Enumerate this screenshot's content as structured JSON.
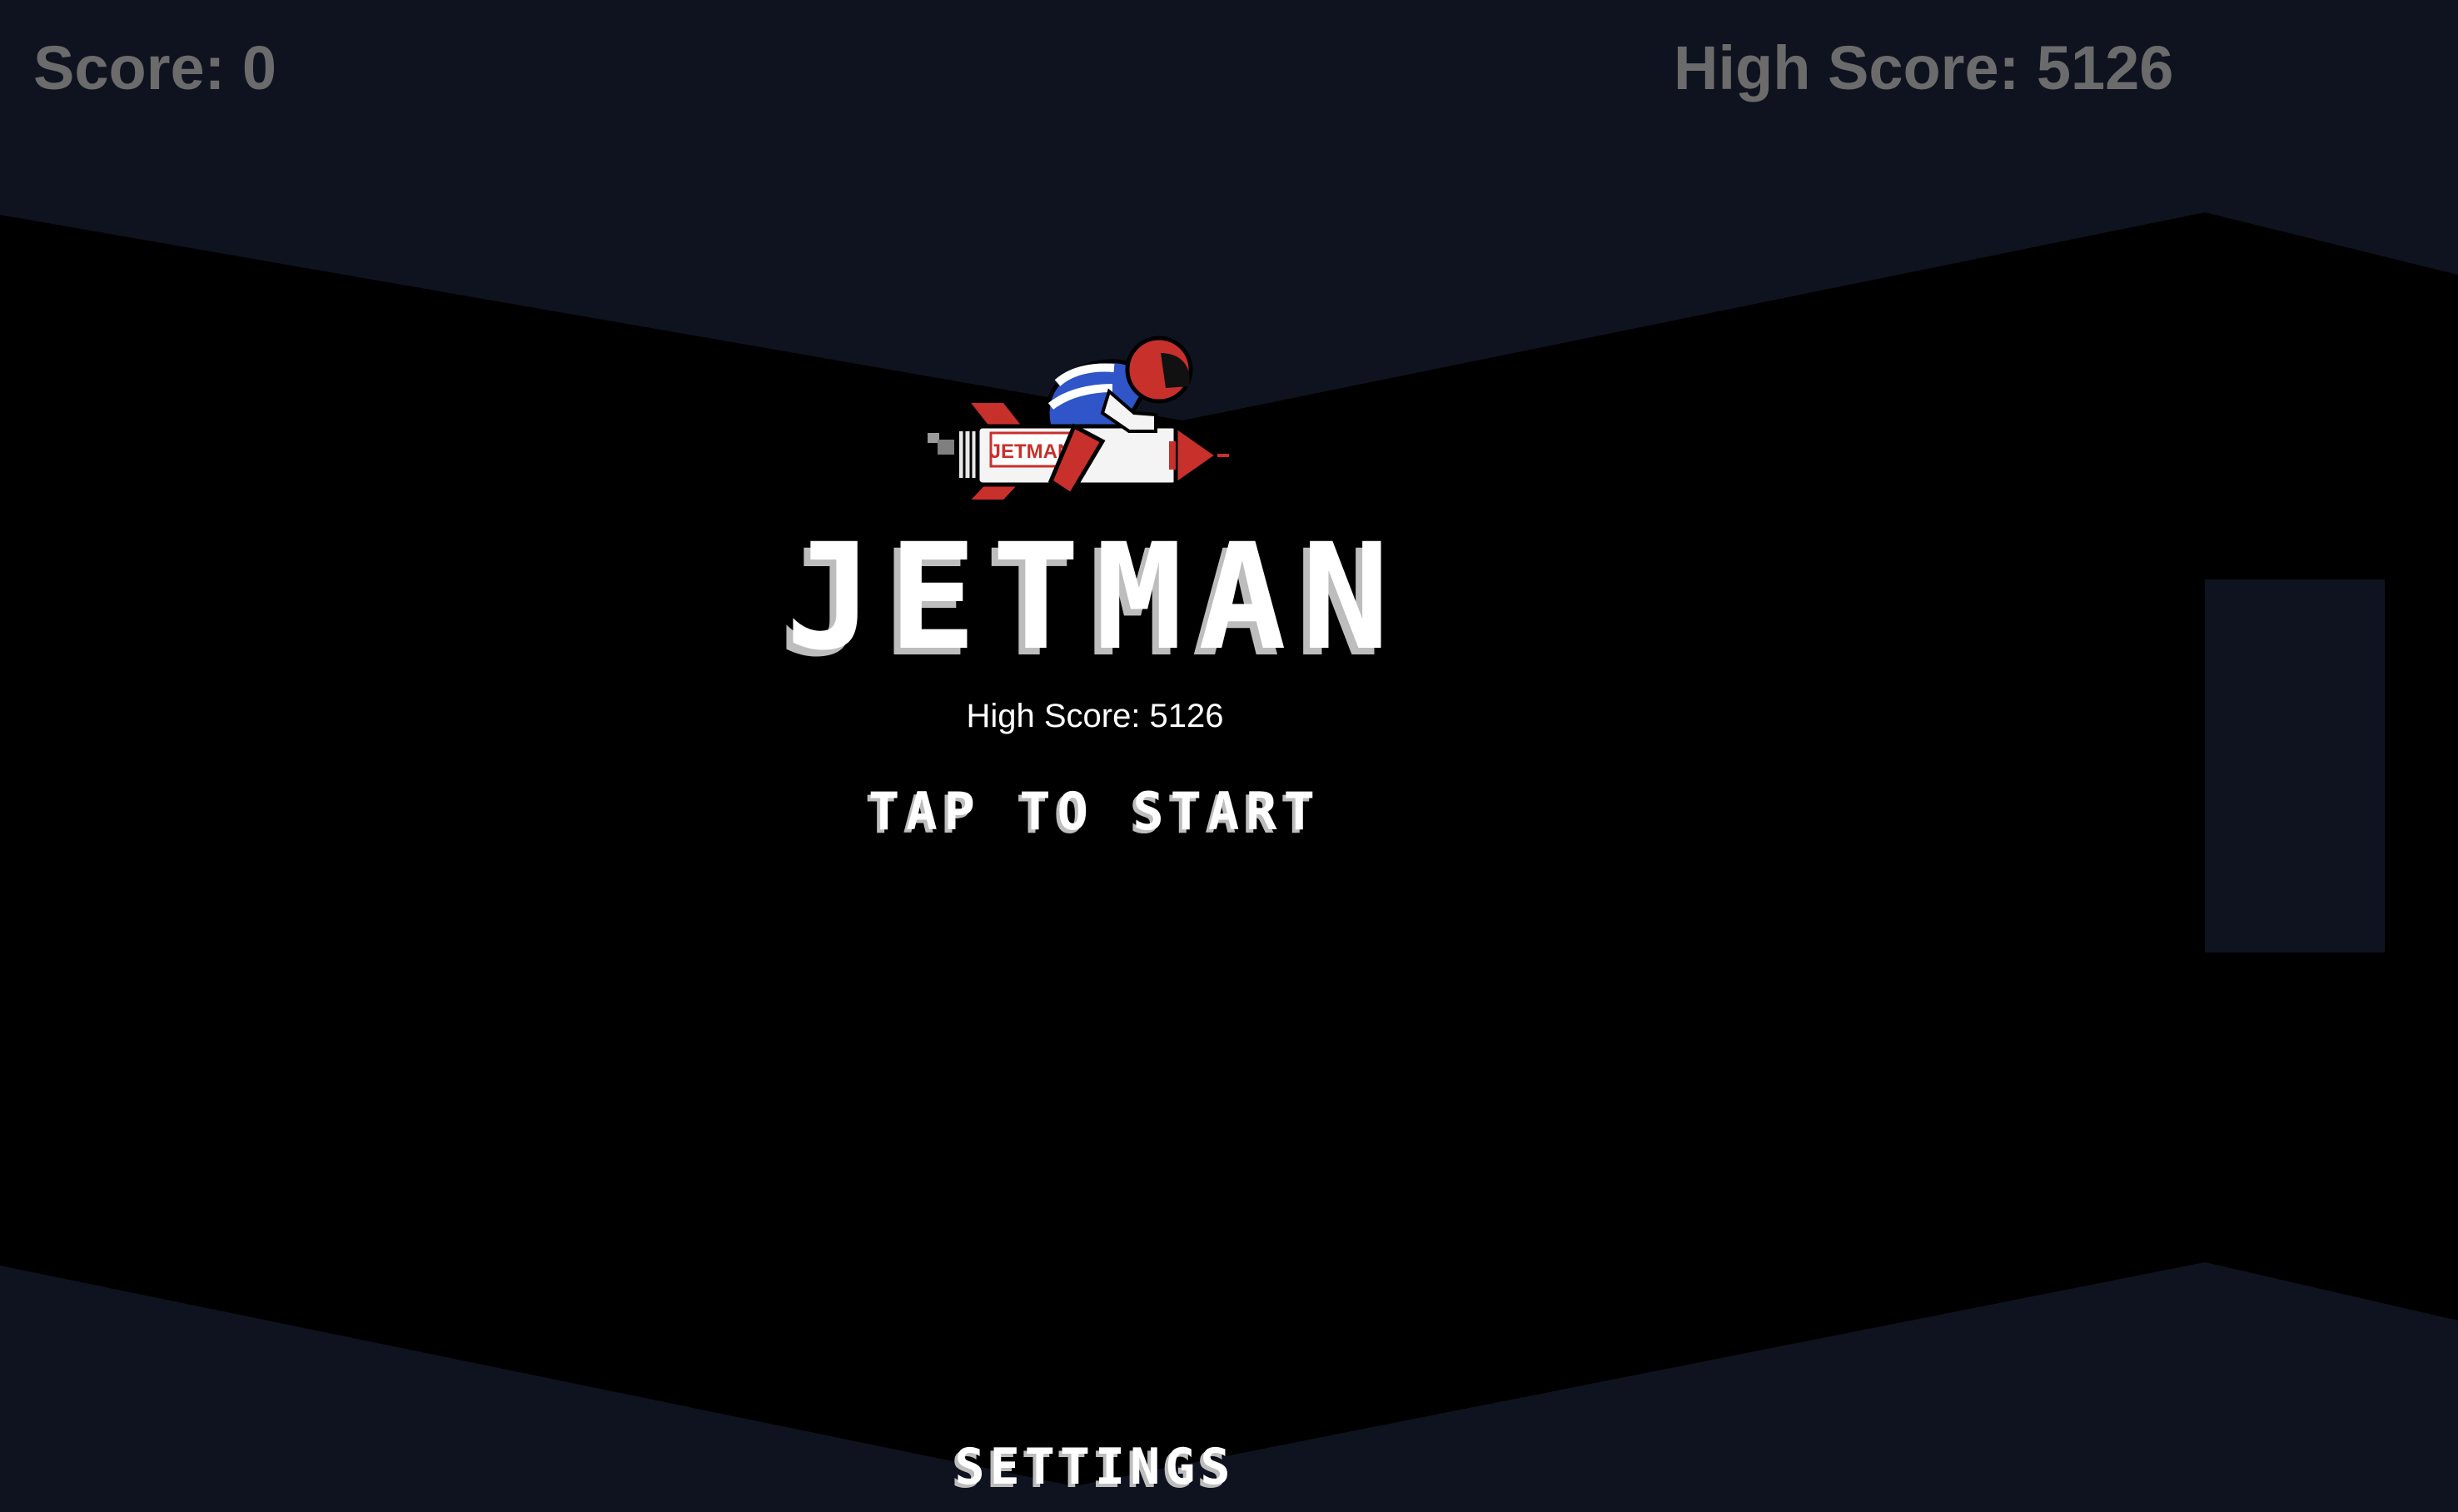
{
  "hud": {
    "score_label": "Score: 0",
    "high_score_label": "High Score: 5126"
  },
  "menu": {
    "title": "JETMAN",
    "high_score_label": "High Score: 5126",
    "start_prompt": "TAP TO START",
    "settings_label": "SETTINGS"
  },
  "player": {
    "rocket_label": "JETMAN",
    "icon": "jetman-rider-icon"
  },
  "colors": {
    "background": "#000000",
    "cave_wall": "#0f1320",
    "hud_text": "#6b6b6b",
    "menu_text": "#ffffff",
    "rocket_red": "#c8302c",
    "suit_blue": "#2f55c8"
  }
}
